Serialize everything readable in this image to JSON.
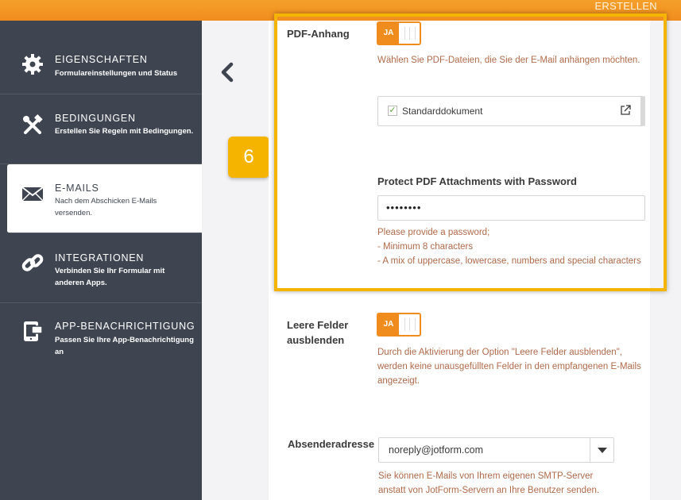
{
  "topbar": {
    "create_label": "ERSTELLEN"
  },
  "sidebar": {
    "items": [
      {
        "title": "EIGENSCHAFTEN",
        "desc": "Formulareinstellungen und Status",
        "icon": "gear-icon"
      },
      {
        "title": "BEDINGUNGEN",
        "desc": "Erstellen Sie Regeln mit Bedingungen.",
        "icon": "tools-icon"
      },
      {
        "title": "E-MAILS",
        "desc": "Nach dem Abschicken E-Mails versenden.",
        "icon": "envelope-icon"
      },
      {
        "title": "INTEGRATIONEN",
        "desc": "Verbinden Sie Ihr Formular mit anderen Apps.",
        "icon": "link-icon"
      },
      {
        "title": "APP-BENACHRICHTIGUNG",
        "desc": "Passen Sie Ihre App-Benachrichtigung an",
        "icon": "mobile-notification-icon"
      }
    ]
  },
  "step_badge": "6",
  "pdf_attachment": {
    "label": "PDF-Anhang",
    "toggle_label": "JA",
    "help": "Wählen Sie PDF-Dateien, die Sie der E-Mail anhängen möchten.",
    "document_label": "Standarddokument",
    "document_checked": true
  },
  "password": {
    "title": "Protect PDF Attachments with Password",
    "value": "••••••••",
    "help_lines": [
      "Please provide a password;",
      "- Minimum 8 characters",
      "- A mix of uppercase, lowercase, numbers and special characters"
    ]
  },
  "hide_empty": {
    "label_line1": "Leere Felder",
    "label_line2": "ausblenden",
    "toggle_label": "JA",
    "help_lines": [
      "Durch die Aktivierung der Option \"Leere Felder ausblenden\",",
      "werden keine unausgefüllten Felder in den empfangenen E-Mails",
      "angezeigt."
    ]
  },
  "sender": {
    "label": "Absenderadresse",
    "value": "noreply@jotform.com",
    "help_lines": [
      "Sie können E-Mails von Ihrem eigenen SMTP-Server",
      "anstatt von JotForm-Servern an Ihre Benutzer senden."
    ]
  },
  "colors": {
    "accent": "#f08c1e",
    "highlight": "#f5b400",
    "sidebar": "#3e4550",
    "help_text": "#b06a4a"
  }
}
